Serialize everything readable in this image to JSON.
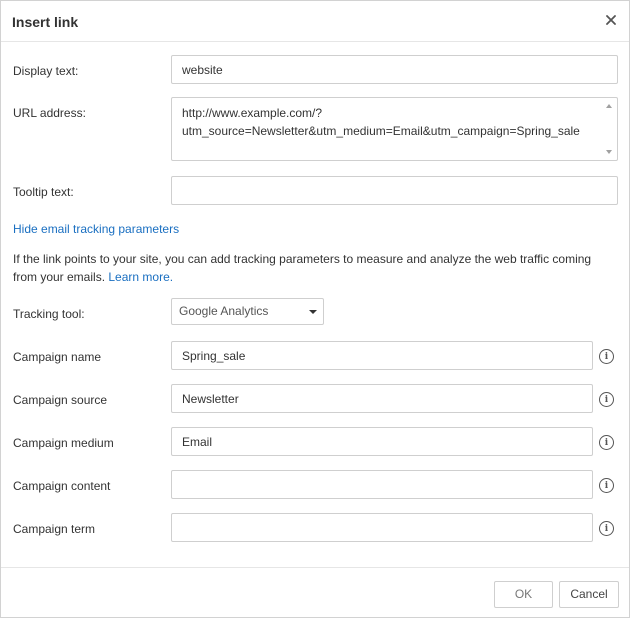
{
  "dialog": {
    "title": "Insert link",
    "close_icon": "close-icon"
  },
  "fields": {
    "display_text_label": "Display text:",
    "display_text_value": "website",
    "url_label": "URL address:",
    "url_value": "http://www.example.com/?\nutm_source=Newsletter&utm_medium=Email&utm_campaign=Spring_sale",
    "tooltip_label": "Tooltip text:",
    "tooltip_value": ""
  },
  "tracking": {
    "toggle_link": "Hide email tracking parameters",
    "description": "If the link points to your site, you can add tracking parameters to measure and analyze the web traffic coming from your emails.",
    "learn_more": "Learn more.",
    "tool_label": "Tracking tool:",
    "tool_selected": "Google Analytics",
    "campaign_name_label": "Campaign name",
    "campaign_name_value": "Spring_sale",
    "campaign_source_label": "Campaign source",
    "campaign_source_value": "Newsletter",
    "campaign_medium_label": "Campaign medium",
    "campaign_medium_value": "Email",
    "campaign_content_label": "Campaign content",
    "campaign_content_value": "",
    "campaign_term_label": "Campaign term",
    "campaign_term_value": "",
    "info_glyph": "i"
  },
  "footer": {
    "ok_label": "OK",
    "cancel_label": "Cancel"
  }
}
